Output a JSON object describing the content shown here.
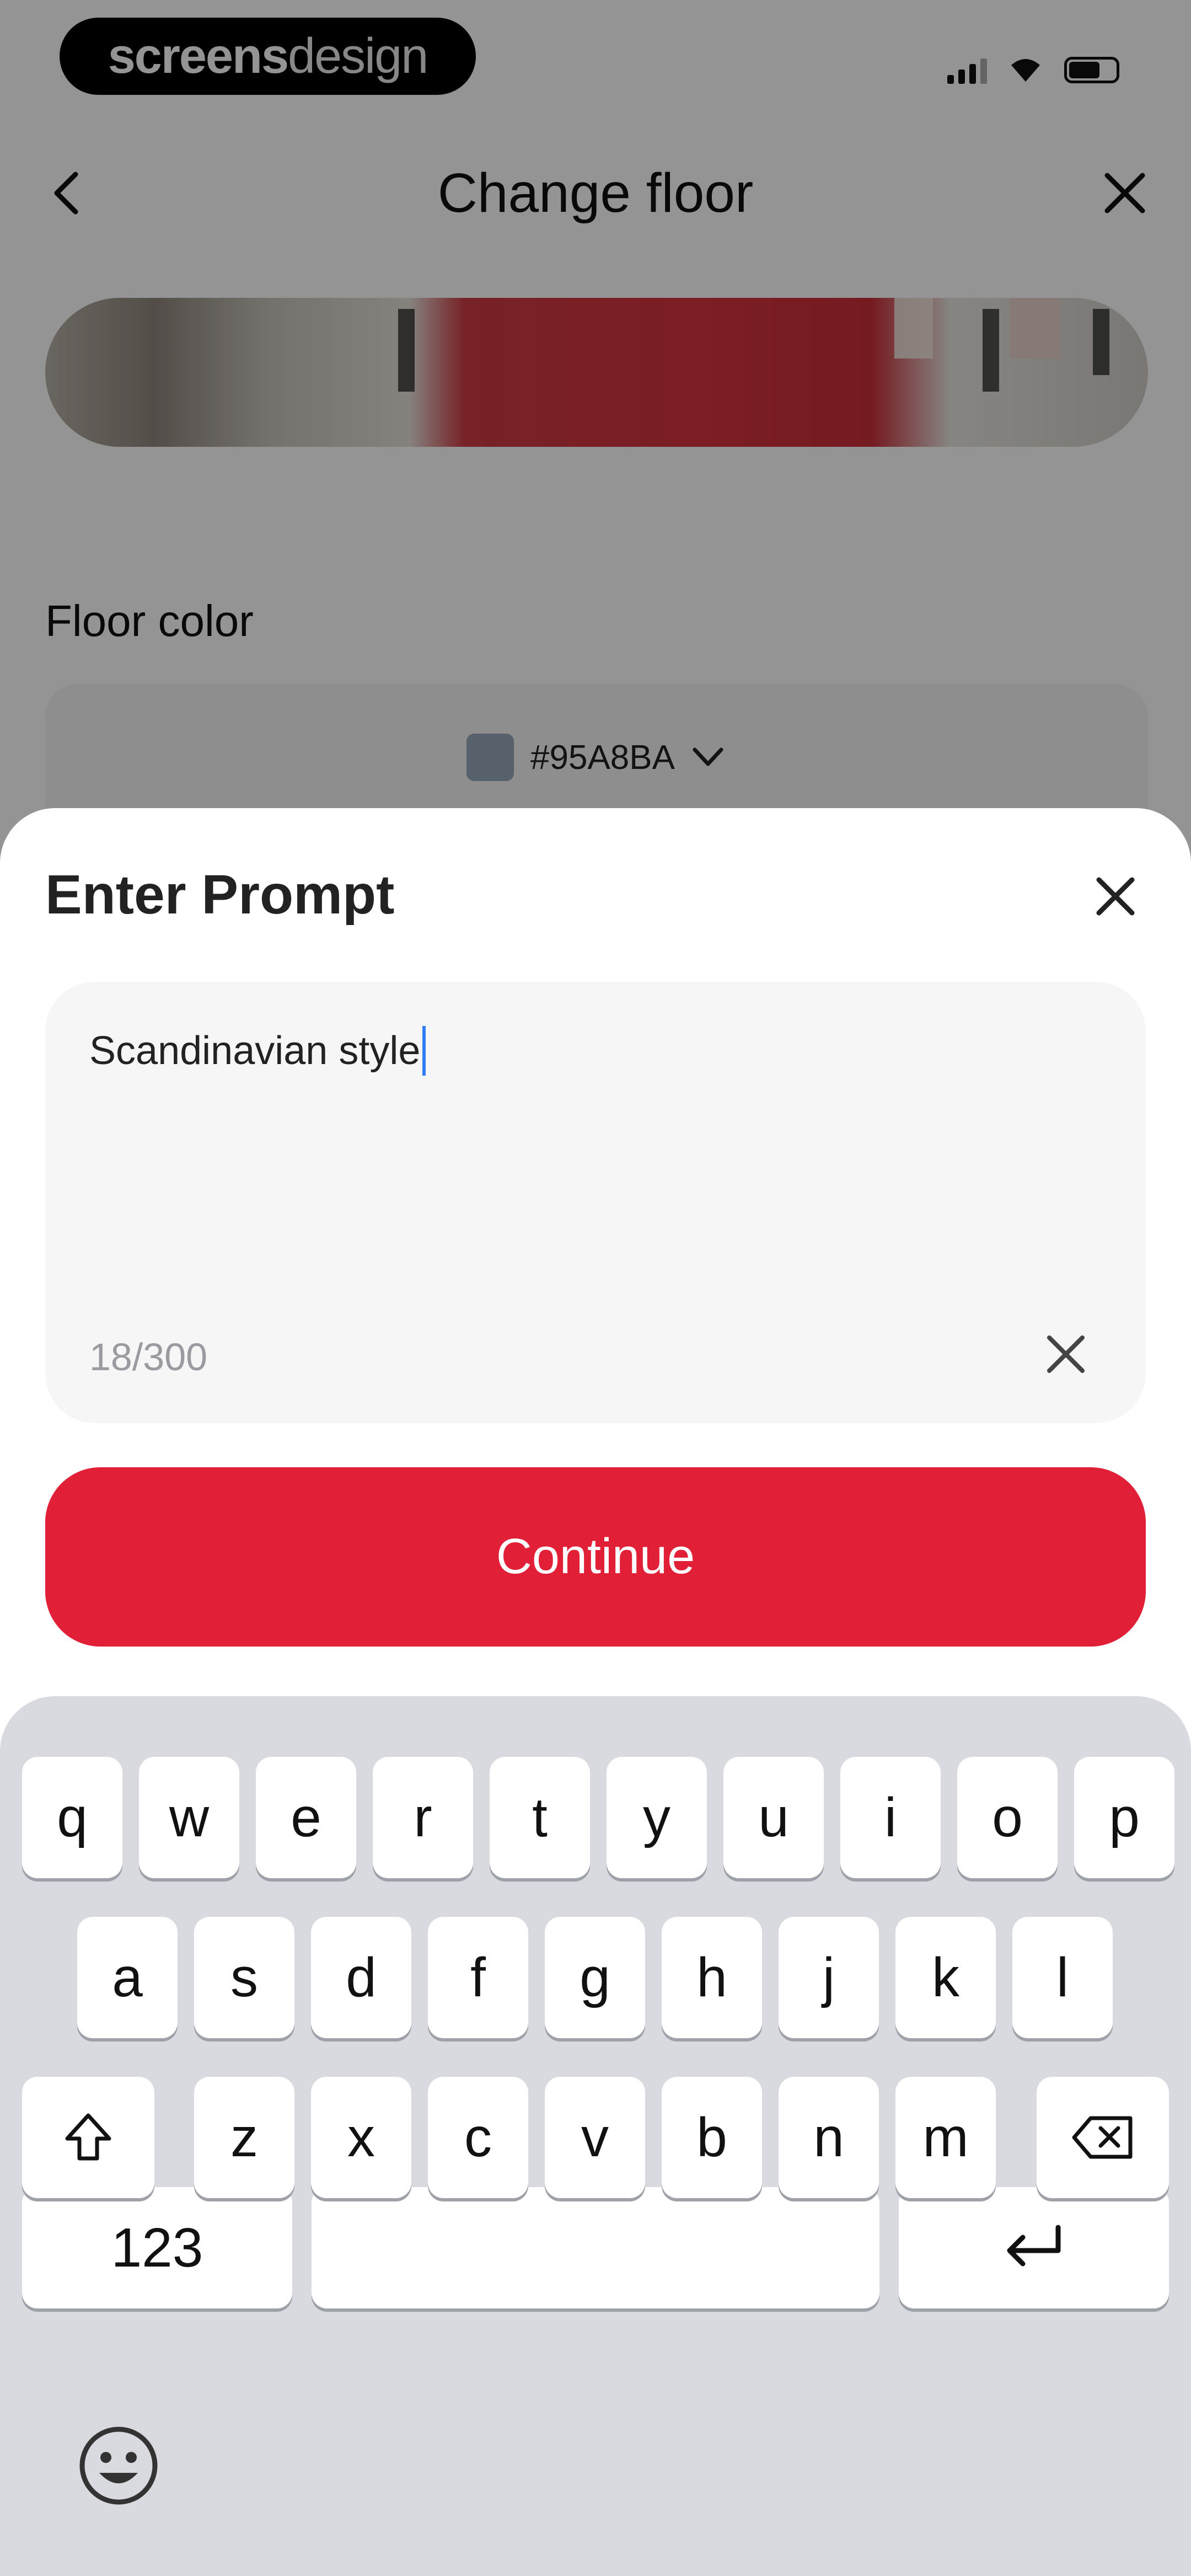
{
  "status_bar": {
    "brand_bold": "screens",
    "brand_light": "design",
    "icons": [
      "cellular-signal-icon",
      "wifi-icon",
      "battery-icon"
    ]
  },
  "nav": {
    "title": "Change floor",
    "back_icon": "chevron-left-icon",
    "close_icon": "close-icon"
  },
  "floor": {
    "label": "Floor color",
    "selected_color_code": "#95A8BA",
    "swatch_color": "#95A8BA"
  },
  "prompt_sheet": {
    "title": "Enter Prompt",
    "input_value": "Scandinavian style",
    "char_count": "18/300",
    "continue_label": "Continue"
  },
  "colors": {
    "accent": "#E11F36",
    "overlay": "rgba(0,0,0,0.42)",
    "keyboard_bg": "#D9DADF",
    "caret": "#2F7DF6"
  },
  "keyboard": {
    "row1": [
      "q",
      "w",
      "e",
      "r",
      "t",
      "y",
      "u",
      "i",
      "o",
      "p"
    ],
    "row2": [
      "a",
      "s",
      "d",
      "f",
      "g",
      "h",
      "j",
      "k",
      "l"
    ],
    "row3": [
      "z",
      "x",
      "c",
      "v",
      "b",
      "n",
      "m"
    ],
    "numbers_label": "123",
    "shift_icon": "shift-icon",
    "backspace_icon": "backspace-icon",
    "return_icon": "return-icon",
    "emoji_icon": "emoji-icon"
  }
}
